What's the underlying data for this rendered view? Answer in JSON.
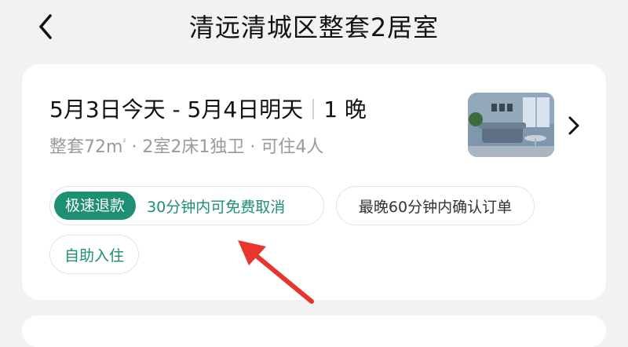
{
  "header": {
    "title": "清远清城区整套2居室"
  },
  "booking": {
    "check_in": "5月3日今天",
    "dash": " - ",
    "check_out": "5月4日明天",
    "nights": "1 晚",
    "details_prefix": "整套72m",
    "details_sup": "²",
    "details_suffix": " · 2室2床1独卫 · 可住4人"
  },
  "tags": {
    "refund_badge": "极速退款",
    "refund_text": "30分钟内可免费取消",
    "confirm_text": "最晚60分钟内确认订单",
    "self_checkin": "自助入住"
  },
  "colors": {
    "accent_green": "#1e8f73",
    "annotation_red": "#e8362f",
    "background": "#f2f2f2"
  },
  "icons": {
    "back": "chevron-left-icon",
    "forward": "chevron-right-icon",
    "annotation": "red-arrow-icon"
  }
}
